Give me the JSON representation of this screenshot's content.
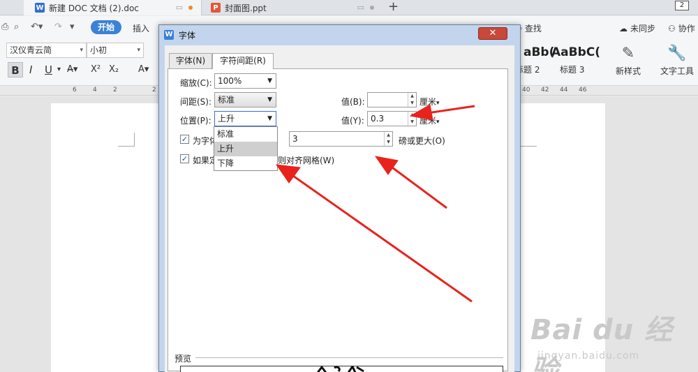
{
  "tabs": [
    {
      "label": "新建 DOC 文档 (2).doc",
      "icon": "W"
    },
    {
      "label": "封面图.ppt",
      "icon": "P"
    }
  ],
  "tab_count": "2",
  "menu": {
    "start": "开始",
    "insert": "插入",
    "search": "查找",
    "sync": "未同步",
    "collab": "协作"
  },
  "toolbar": {
    "font_name": "汉仪青云简",
    "font_size": "小初",
    "bold": "B",
    "italic": "I",
    "underline": "U",
    "superscript": "X²",
    "subscript": "X₂"
  },
  "styles": {
    "sample1": "aBb(",
    "sample2": "AaBbC(",
    "name1": "标题 2",
    "name2": "标题 3",
    "new_style": "新样式",
    "text_tool": "文字工具"
  },
  "ruler": [
    "6",
    "4",
    "2",
    "2",
    "40",
    "42",
    "44",
    "46"
  ],
  "dialog": {
    "title": "字体",
    "close": "✕",
    "tab_font": "字体(N)",
    "tab_spacing": "字符间距(R)",
    "scale_label": "缩放(C):",
    "scale_value": "100%",
    "spacing_label": "间距(S):",
    "spacing_value": "标准",
    "position_label": "位置(P):",
    "position_value": "上升",
    "value_b_label": "值(B):",
    "value_b": "",
    "value_y_label": "值(Y):",
    "value_y": "0.3",
    "unit_b": "厘米",
    "unit_y": "厘米",
    "kerning_label": "为字体",
    "kerning_value": "3",
    "kerning_unit": "磅或更大(O)",
    "grid_label_start": "如果定",
    "grid_label_end": "则对齐网格(W)",
    "position_options": [
      "标准",
      "上升",
      "下降"
    ],
    "preview": "预览"
  },
  "watermark": {
    "main": "Bai du 经验",
    "sub": "jingyan.baidu.com"
  },
  "colors": {
    "accent": "#3a82d8",
    "close_red": "#c9483a",
    "arrow_red": "#e8231b"
  }
}
